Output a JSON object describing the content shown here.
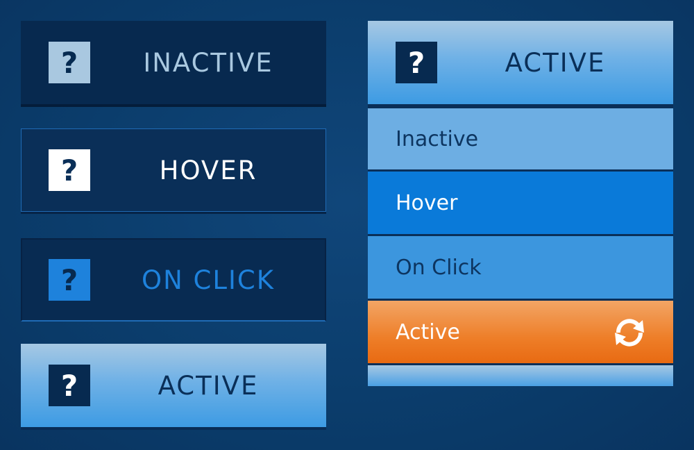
{
  "left_buttons": [
    {
      "state": "inactive",
      "label": "INACTIVE",
      "icon": "question-mark-icon"
    },
    {
      "state": "hover",
      "label": "HOVER",
      "icon": "question-mark-icon"
    },
    {
      "state": "on_click",
      "label": "ON CLICK",
      "icon": "question-mark-icon"
    },
    {
      "state": "active",
      "label": "ACTIVE",
      "icon": "question-mark-icon"
    }
  ],
  "icon_glyph": "?",
  "menu": {
    "header": {
      "label": "ACTIVE",
      "icon": "question-mark-icon"
    },
    "items": [
      {
        "state": "inactive",
        "label": "Inactive"
      },
      {
        "state": "hover",
        "label": "Hover"
      },
      {
        "state": "on_click",
        "label": "On Click"
      },
      {
        "state": "active",
        "label": "Active",
        "icon": "refresh-icon"
      }
    ]
  },
  "colors": {
    "background": "#0b3d6c",
    "dark_navy": "#07294f",
    "light_blue": "#a9c8e0",
    "click_blue": "#1e82dc",
    "hover_blue": "#0a7ad9",
    "orange": "#ee7e28"
  }
}
